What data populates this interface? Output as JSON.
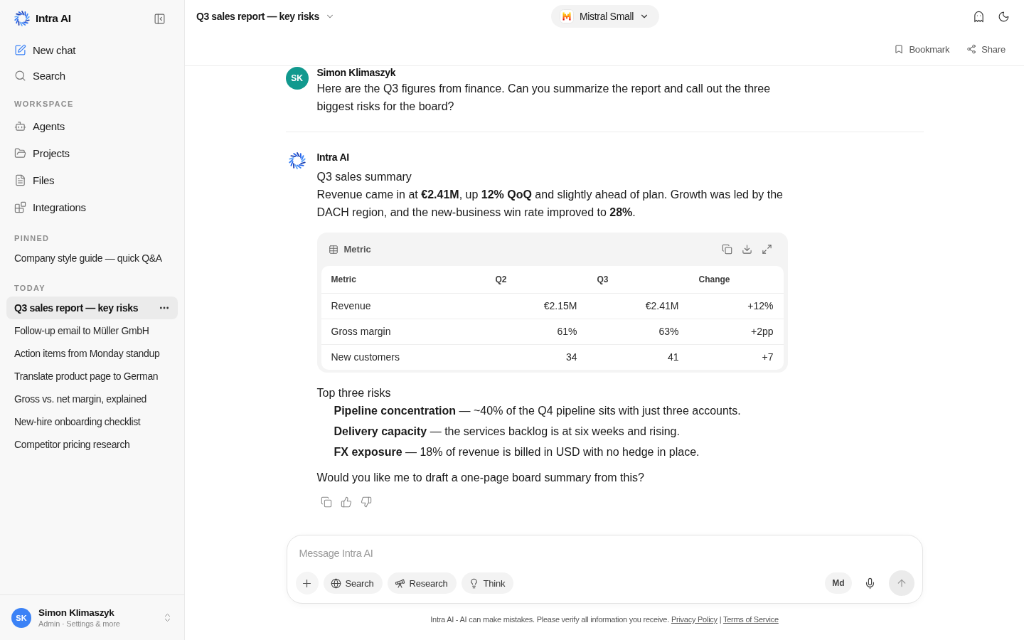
{
  "sidebar": {
    "brand": "Intra AI",
    "actions": [
      {
        "kind": "compose",
        "label": "New chat"
      },
      {
        "kind": "search",
        "label": "Search"
      }
    ],
    "workspace": {
      "heading": "WORKSPACE",
      "items": [
        {
          "kind": "agents",
          "label": "Agents"
        },
        {
          "kind": "projects",
          "label": "Projects"
        },
        {
          "kind": "files",
          "label": "Files"
        },
        {
          "kind": "integrations",
          "label": "Integrations"
        }
      ]
    },
    "pinned": {
      "heading": "PINNED",
      "chats": [
        {
          "title": "Company style guide — quick Q&A",
          "selected": false
        }
      ]
    },
    "today": {
      "heading": "TODAY",
      "chats": [
        {
          "title": "Q3 sales report — key risks",
          "selected": true
        },
        {
          "title": "Follow-up email to Müller GmbH",
          "selected": false
        },
        {
          "title": "Action items from Monday standup",
          "selected": false
        },
        {
          "title": "Translate product page to German",
          "selected": false
        },
        {
          "title": "Gross vs. net margin, explained",
          "selected": false
        },
        {
          "title": "New-hire onboarding checklist",
          "selected": false
        },
        {
          "title": "Competitor pricing research",
          "selected": false
        }
      ]
    },
    "user": {
      "initials": "SK",
      "name": "Simon Klimaszyk",
      "subtitle": "Admin · Settings & more"
    }
  },
  "header": {
    "title": "Q3 sales report — key risks",
    "model": {
      "name": "Mistral Small"
    },
    "actions": [
      {
        "kind": "bookmark",
        "label": "Bookmark"
      },
      {
        "kind": "share",
        "label": "Share"
      }
    ]
  },
  "messages": [
    {
      "kind": "user",
      "author": "Simon Klimaszyk",
      "initials": "SK",
      "text": "Here are the Q3 figures from finance. Can you summarize the report and call out the three biggest risks for the board?"
    },
    {
      "kind": "assistant",
      "author": "Intra AI",
      "blocks": [
        {
          "kind": "paragraph",
          "text": "Q3 sales summary"
        },
        {
          "kind": "paragraph",
          "text": "Revenue came in at **€2.41M**, up **12% QoQ** and slightly ahead of plan. Growth was led by the DACH region, and the new-business win rate improved to **28%**."
        },
        {
          "kind": "table",
          "title": "Metric",
          "columns": [
            "Metric",
            "Q2",
            "Q3",
            "Change"
          ],
          "rows": [
            [
              "Revenue",
              "€2.15M",
              "€2.41M",
              "+12%"
            ],
            [
              "Gross margin",
              "61%",
              "63%",
              "+2pp"
            ],
            [
              "New customers",
              "34",
              "41",
              "+7"
            ]
          ]
        },
        {
          "kind": "paragraph",
          "text": "Top three risks"
        },
        {
          "kind": "list",
          "items": [
            "**Pipeline concentration** — ~40% of the Q4 pipeline sits with just three accounts.",
            "**Delivery capacity** — the services backlog is at six weeks and rising.",
            "**FX exposure** — 18% of revenue is billed in USD with no hedge in place."
          ]
        },
        {
          "kind": "paragraph",
          "text": "Would you like me to draft a one-page board summary from this?"
        }
      ]
    }
  ],
  "composer": {
    "placeholder": "Message Intra AI",
    "tools": [
      {
        "kind": "search",
        "label": "Search"
      },
      {
        "kind": "research",
        "label": "Research"
      },
      {
        "kind": "think",
        "label": "Think"
      }
    ],
    "format": "Md"
  },
  "footer": {
    "notice": "Intra AI - AI can make mistakes. Please verify all information you receive.",
    "links": [
      "Privacy Policy",
      "Terms of Service"
    ],
    "separator": "|"
  }
}
